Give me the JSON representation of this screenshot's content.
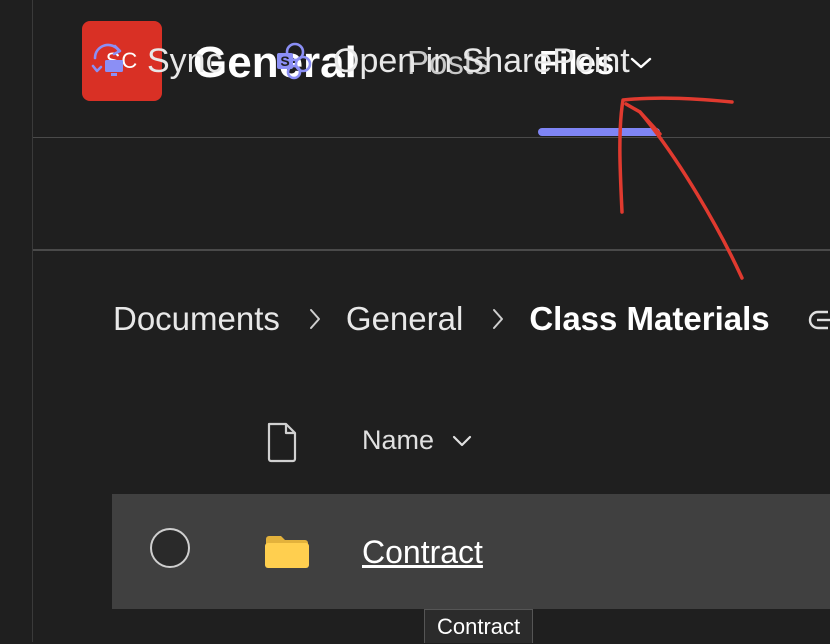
{
  "channel": {
    "avatar_initials": "SC",
    "avatar_color": "#d93025",
    "title": "General"
  },
  "tabs": [
    {
      "label": "Posts",
      "active": false
    },
    {
      "label": "Files",
      "active": true,
      "has_dropdown": true
    }
  ],
  "accent_color": "#7f85f5",
  "toolbar": {
    "sync_label": "Sync",
    "sharepoint_label": "Open in SharePoint"
  },
  "breadcrumb": [
    "Documents",
    "General",
    "Class Materials"
  ],
  "table": {
    "name_header": "Name",
    "rows": [
      {
        "type": "folder",
        "name": "Contract"
      }
    ]
  },
  "tooltip": "Contract",
  "annotation_color": "#e03a2f"
}
